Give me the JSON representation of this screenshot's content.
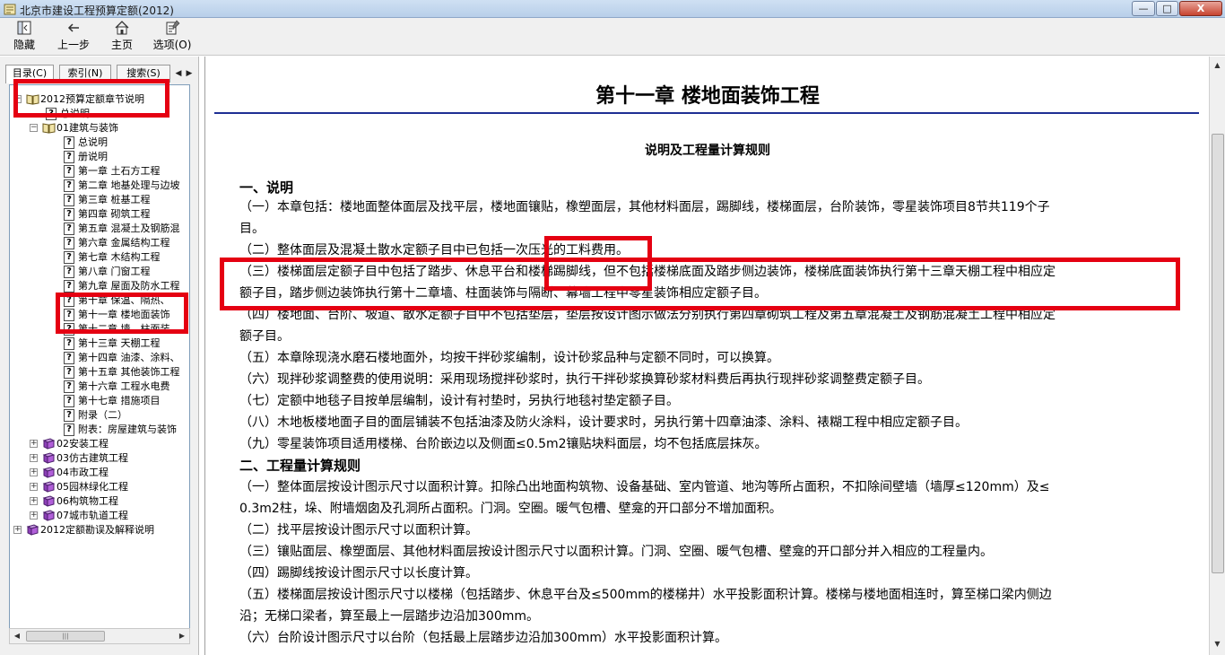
{
  "window": {
    "title": "北京市建设工程预算定额(2012)",
    "min_glyph": "—",
    "max_glyph": "□",
    "close_glyph": "X"
  },
  "toolbar": {
    "hide_label": "隐藏",
    "back_label": "上一步",
    "home_label": "主页",
    "options_label": "选项(O)"
  },
  "tabs": {
    "contents": "目录(C)",
    "index": "索引(N)",
    "search": "搜索(S)",
    "prev_glyph": "◀",
    "next_glyph": "▶"
  },
  "tree": {
    "items": [
      {
        "label": "2012预算定额章节说明",
        "icon": "book-open-icon",
        "expander": "−"
      },
      {
        "label": "总说明",
        "icon": "help-page-icon"
      },
      {
        "label": "01建筑与装饰",
        "icon": "book-open-icon",
        "expander": "−"
      },
      {
        "label": "总说明",
        "icon": "help-page-icon"
      },
      {
        "label": "册说明",
        "icon": "help-page-icon"
      },
      {
        "label": "第一章  土石方工程",
        "icon": "help-page-icon"
      },
      {
        "label": "第二章  地基处理与边坡",
        "icon": "help-page-icon"
      },
      {
        "label": "第三章  桩基工程",
        "icon": "help-page-icon"
      },
      {
        "label": "第四章  砌筑工程",
        "icon": "help-page-icon"
      },
      {
        "label": "第五章  混凝土及钢筋混",
        "icon": "help-page-icon"
      },
      {
        "label": "第六章  金属结构工程",
        "icon": "help-page-icon"
      },
      {
        "label": "第七章  木结构工程",
        "icon": "help-page-icon"
      },
      {
        "label": "第八章  门窗工程",
        "icon": "help-page-icon"
      },
      {
        "label": "第九章  屋面及防水工程",
        "icon": "help-page-icon"
      },
      {
        "label": "第十章  保温、隔热、",
        "icon": "help-page-icon"
      },
      {
        "label": "第十一章  楼地面装饰",
        "icon": "help-page-icon"
      },
      {
        "label": "第十二章  墙、柱面装",
        "icon": "help-page-icon"
      },
      {
        "label": "第十三章  天棚工程",
        "icon": "help-page-icon"
      },
      {
        "label": "第十四章  油漆、涂料、",
        "icon": "help-page-icon"
      },
      {
        "label": "第十五章  其他装饰工程",
        "icon": "help-page-icon"
      },
      {
        "label": "第十六章  工程水电费",
        "icon": "help-page-icon"
      },
      {
        "label": "第十七章  措施项目",
        "icon": "help-page-icon"
      },
      {
        "label": "附录（二）",
        "icon": "help-page-icon"
      },
      {
        "label": "附表：房屋建筑与装饰",
        "icon": "help-page-icon"
      },
      {
        "label": "02安装工程",
        "icon": "book-closed-icon",
        "expander": "+"
      },
      {
        "label": "03仿古建筑工程",
        "icon": "book-closed-icon",
        "expander": "+"
      },
      {
        "label": "04市政工程",
        "icon": "book-closed-icon",
        "expander": "+"
      },
      {
        "label": "05园林绿化工程",
        "icon": "book-closed-icon",
        "expander": "+"
      },
      {
        "label": "06构筑物工程",
        "icon": "book-closed-icon",
        "expander": "+"
      },
      {
        "label": "07城市轨道工程",
        "icon": "book-closed-icon",
        "expander": "+"
      },
      {
        "label": "2012定额勘误及解释说明",
        "icon": "book-closed-icon",
        "expander": "+"
      }
    ]
  },
  "content": {
    "chapter_title": "第十一章  楼地面装饰工程",
    "section_title": "说明及工程量计算规则",
    "lines": [
      "一、说明",
      "（一）本章包括：楼地面整体面层及找平层，楼地面镶贴，橡塑面层，其他材料面层，踢脚线，楼梯面层，台阶装饰，零星装饰项目8节共119个子",
      "目。",
      "（二）整体面层及混凝土散水定额子目中已包括一次压光的工料费用。",
      "（三）楼梯面层定额子目中包括了踏步、休息平台和楼梯踢脚线，但不包括楼梯底面及踏步侧边装饰，楼梯底面装饰执行第十三章天棚工程中相应定",
      "额子目，踏步侧边装饰执行第十二章墙、柱面装饰与隔断、幕墙工程中零星装饰相应定额子目。",
      "（四）楼地面、台阶、坡道、散水定额子目中不包括垫层，垫层按设计图示做法分别执行第四章砌筑工程及第五章混凝土及钢筋混凝土工程中相应定",
      "额子目。",
      "（五）本章除现浇水磨石楼地面外，均按干拌砂浆编制，设计砂浆品种与定额不同时，可以换算。",
      "（六）现拌砂浆调整费的使用说明：采用现场搅拌砂浆时，执行干拌砂浆换算砂浆材料费后再执行现拌砂浆调整费定额子目。",
      "（七）定额中地毯子目按单层编制，设计有衬垫时，另执行地毯衬垫定额子目。",
      "（八）木地板楼地面子目的面层铺装不包括油漆及防火涂料，设计要求时，另执行第十四章油漆、涂料、裱糊工程中相应定额子目。",
      "（九）零星装饰项目适用楼梯、台阶嵌边以及侧面≤0.5m2镶贴块料面层，均不包括底层抹灰。",
      "二、工程量计算规则",
      "（一）整体面层按设计图示尺寸以面积计算。扣除凸出地面构筑物、设备基础、室内管道、地沟等所占面积，不扣除间壁墙（墙厚≤120mm）及≤",
      "0.3m2柱，垛、附墙烟囱及孔洞所占面积。门洞。空圈。暖气包槽、壁龛的开口部分不增加面积。",
      "（二）找平层按设计图示尺寸以面积计算。",
      "（三）镶贴面层、橡塑面层、其他材料面层按设计图示尺寸以面积计算。门洞、空圈、暖气包槽、壁龛的开口部分并入相应的工程量内。",
      "（四）踢脚线按设计图示尺寸以长度计算。",
      "（五）楼梯面层按设计图示尺寸以楼梯（包括踏步、休息平台及≤500mm的楼梯井）水平投影面积计算。楼梯与楼地面相连时，算至梯口梁内侧边",
      "沿；无梯口梁者，算至最上一层踏步边沿加300mm。",
      "（六）台阶设计图示尺寸以台阶（包括最上层踏步边沿加300mm）水平投影面积计算。"
    ]
  },
  "scroll": {
    "up_glyph": "▲",
    "down_glyph": "▼",
    "left_glyph": "◀",
    "right_glyph": "▶",
    "thumb_grip": "|||"
  },
  "colors": {
    "highlight": "#e50012",
    "title_rule": "#1e2f94"
  }
}
